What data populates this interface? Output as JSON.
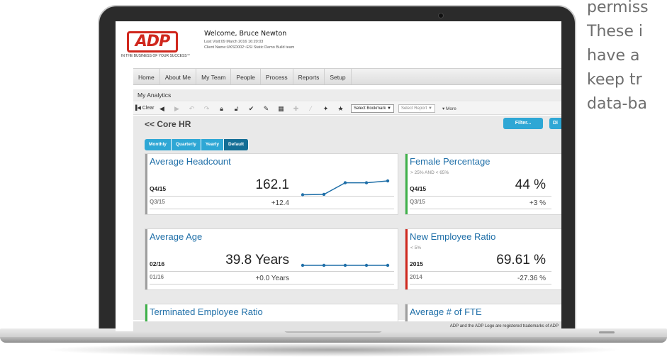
{
  "side_text": [
    "permiss",
    "These i",
    "have a",
    "keep tr",
    "data-ba"
  ],
  "logo": {
    "mark": "ADP",
    "tagline": "IN THE BUSINESS OF YOUR SUCCESS℠"
  },
  "welcome": {
    "title": "Welcome, Bruce Newton",
    "last_visit": "Last Visit:09 March 2016 16:20:03",
    "client": "Client Name:UKSD002~ESI Static Demo Build team"
  },
  "nav": [
    "Home",
    "About Me",
    "My Team",
    "People",
    "Process",
    "Reports",
    "Setup"
  ],
  "analytics_title": "My Analytics",
  "toolbar": {
    "clear": "Clear",
    "bookmark_select": "Select Bookmark",
    "report_select": "Select Report",
    "more": "More"
  },
  "content": {
    "breadcrumb": "<< Core HR",
    "filter": "Filter...",
    "di": "Di",
    "periods": [
      "Monthly",
      "Quarterly",
      "Yearly",
      "Default"
    ]
  },
  "cards": [
    {
      "title": "Average Headcount",
      "subtitle": "",
      "period1": "Q4/15",
      "value1": "162.1",
      "period2": "Q3/15",
      "value2": "+12.4",
      "bar_color": "#9e9e9e",
      "spark": [
        0.25,
        0.27,
        0.9,
        0.9,
        1.0
      ]
    },
    {
      "title": "Female Percentage",
      "subtitle": "> 25% AND < 65%",
      "period1": "Q4/15",
      "value1": "44 %",
      "period2": "Q3/15",
      "value2": "+3 %",
      "bar_color": "#3eb149"
    },
    {
      "title": "Average Age",
      "subtitle": "",
      "period1": "02/16",
      "value1": "39.8 Years",
      "period2": "01/16",
      "value2": "+0.0 Years",
      "bar_color": "#9e9e9e",
      "spark": [
        0.5,
        0.5,
        0.5,
        0.5,
        0.5
      ]
    },
    {
      "title": "New Employee Ratio",
      "subtitle": "< 5%",
      "period1": "2015",
      "value1": "69.61 %",
      "period2": "2014",
      "value2": "-27.36 %",
      "bar_color": "#d0271d"
    },
    {
      "title": "Terminated Employee Ratio",
      "subtitle": "",
      "bar_color": "#3eb149"
    },
    {
      "title": "Average # of FTE",
      "subtitle": "",
      "bar_color": "#9e9e9e"
    }
  ],
  "footer": "ADP and the ADP Logo are registered trademarks of ADP"
}
